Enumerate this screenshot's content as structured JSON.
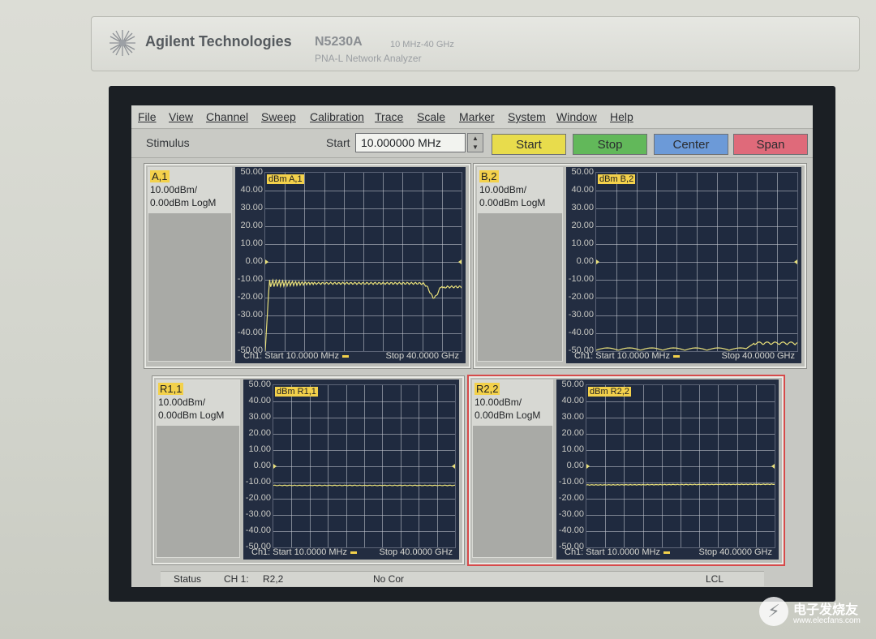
{
  "device": {
    "brand": "Agilent Technologies",
    "model": "N5230A",
    "range": "10 MHz-40 GHz",
    "description": "PNA-L Network Analyzer"
  },
  "menu": [
    "File",
    "View",
    "Channel",
    "Sweep",
    "Calibration",
    "Trace",
    "Scale",
    "Marker",
    "System",
    "Window",
    "Help"
  ],
  "stimulus": {
    "label": "Stimulus",
    "start_label": "Start",
    "start_value": "10.000000 MHz",
    "buttons": [
      {
        "label": "Start",
        "color": "#e8dc4c"
      },
      {
        "label": "Stop",
        "color": "#62b85a"
      },
      {
        "label": "Center",
        "color": "#6c9ad8"
      },
      {
        "label": "Span",
        "color": "#df6a7a"
      }
    ]
  },
  "y_ticks": [
    "50.00",
    "40.00",
    "30.00",
    "20.00",
    "10.00",
    "0.00",
    "-10.00",
    "-20.00",
    "-30.00",
    "-40.00",
    "-50.00"
  ],
  "windows": [
    {
      "trace": "A,1",
      "tag": "dBm A,1",
      "scale": "10.00dBm/",
      "ref": "0.00dBm  LogM",
      "footer_start": "Ch1: Start  10.0000 MHz",
      "footer_stop": "Stop  40.0000 GHz"
    },
    {
      "trace": "B,2",
      "tag": "dBm B,2",
      "scale": "10.00dBm/",
      "ref": "0.00dBm  LogM",
      "footer_start": "Ch1: Start  10.0000 MHz",
      "footer_stop": "Stop  40.0000 GHz"
    },
    {
      "trace": "R1,1",
      "tag": "dBm R1,1",
      "scale": "10.00dBm/",
      "ref": "0.00dBm  LogM",
      "footer_start": "Ch1: Start  10.0000 MHz",
      "footer_stop": "Stop  40.0000 GHz"
    },
    {
      "trace": "R2,2",
      "tag": "dBm R2,2",
      "scale": "10.00dBm/",
      "ref": "0.00dBm  LogM",
      "footer_start": "Ch1: Start  10.0000 MHz",
      "footer_stop": "Stop  40.0000 GHz"
    }
  ],
  "status": {
    "label": "Status",
    "channel": "CH 1:",
    "trace": "R2,2",
    "correction": "No Cor",
    "control": "LCL"
  },
  "watermark": {
    "text": "电子发烧友",
    "url": "www.elecfans.com"
  },
  "colors": {
    "trace": "#e9e07a",
    "grid": "#c8ccd6",
    "plot_bg": "#1f2a3f",
    "active_border": "#d64a4a"
  }
}
